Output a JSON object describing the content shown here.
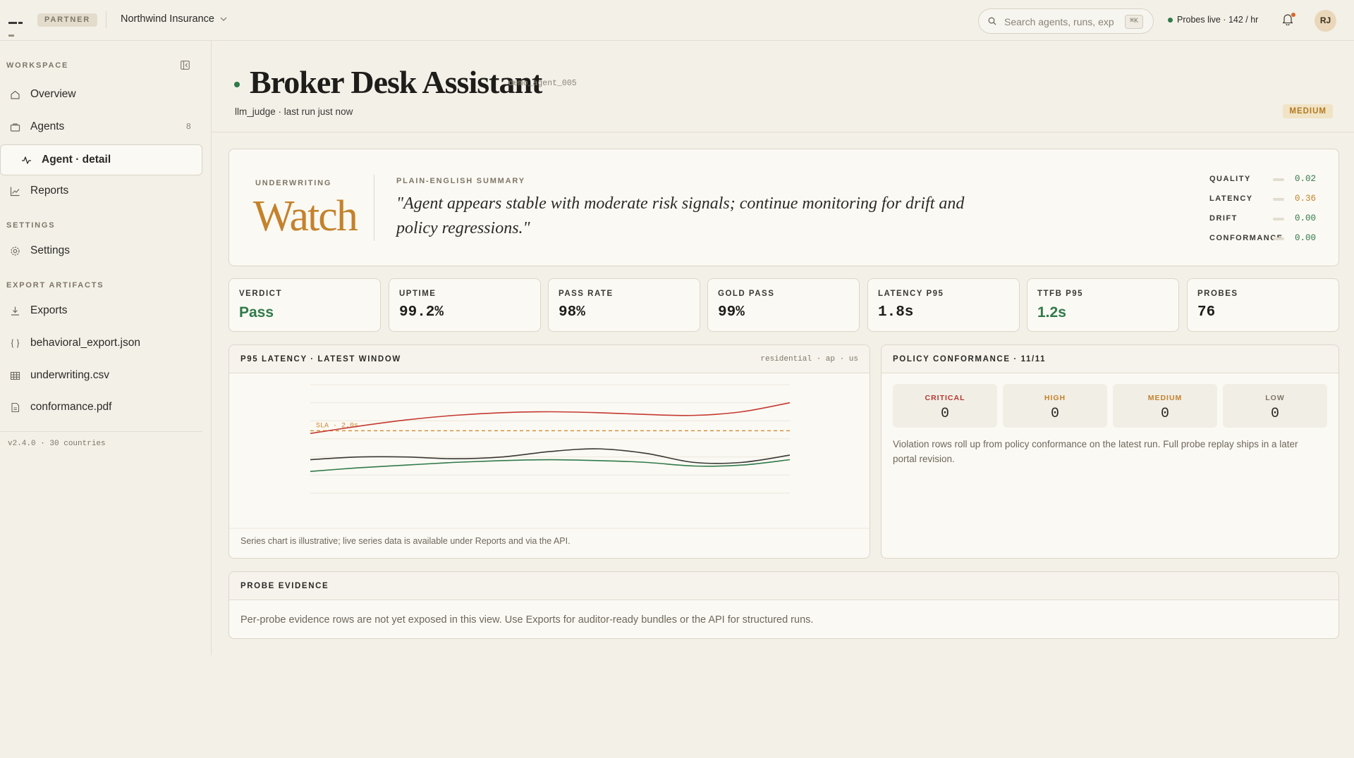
{
  "topbar": {
    "partner_label": "PARTNER",
    "org_name": "Northwind Insurance",
    "search_placeholder": "Search agents, runs, exp",
    "search_shortcut": "⌘K",
    "probes_status": "Probes live · 142 / hr",
    "avatar_initials": "RJ"
  },
  "sidebar": {
    "workspace_label": "WORKSPACE",
    "workspace_items": [
      {
        "label": "Overview",
        "icon": "home-icon"
      },
      {
        "label": "Agents",
        "icon": "briefcase-icon",
        "count": "8"
      },
      {
        "label": "Agent · detail",
        "icon": "pulse-icon",
        "active": true
      },
      {
        "label": "Reports",
        "icon": "chart-icon"
      }
    ],
    "settings_label": "SETTINGS",
    "settings_items": [
      {
        "label": "Settings",
        "icon": "gear-icon"
      }
    ],
    "export_label": "EXPORT ARTIFACTS",
    "export_items": [
      {
        "label": "Exports",
        "icon": "download-icon"
      },
      {
        "label": "behavioral_export.json",
        "icon": "braces-icon"
      },
      {
        "label": "underwriting.csv",
        "icon": "table-icon"
      },
      {
        "label": "conformance.pdf",
        "icon": "document-icon"
      }
    ],
    "version": "v2.4.0 · 30 countries"
  },
  "agent": {
    "name": "Broker Desk Assistant",
    "id": "demo_agent_005",
    "subtitle": "llm_judge · last run just now",
    "risk_badge": "MEDIUM"
  },
  "summary": {
    "category": "UNDERWRITING",
    "verdict": "Watch",
    "label": "PLAIN-ENGLISH SUMMARY",
    "quote": "\"Agent appears stable with moderate risk signals; continue monitoring for drift and policy regressions.\"",
    "metrics": [
      {
        "label": "QUALITY",
        "value": "0.02",
        "level": 0.02,
        "color": "#2f7a4a"
      },
      {
        "label": "LATENCY",
        "value": "0.36",
        "level": 0.36,
        "color": "#c4822c"
      },
      {
        "label": "DRIFT",
        "value": "0.00",
        "level": 0.0,
        "color": "#2f7a4a"
      },
      {
        "label": "CONFORMANCE",
        "value": "0.00",
        "level": 0.0,
        "color": "#2f7a4a"
      }
    ]
  },
  "kpis": [
    {
      "label": "VERDICT",
      "value": "Pass",
      "good": true
    },
    {
      "label": "UPTIME",
      "value": "99.2%"
    },
    {
      "label": "PASS RATE",
      "value": "98%"
    },
    {
      "label": "GOLD PASS",
      "value": "99%"
    },
    {
      "label": "LATENCY P95",
      "value": "1.8s"
    },
    {
      "label": "TTFB P95",
      "value": "1.2s",
      "good": true
    },
    {
      "label": "PROBES",
      "value": "76"
    }
  ],
  "latency_panel": {
    "title": "P95 LATENCY · LATEST WINDOW",
    "tags": "residential · ap · us",
    "footnote": "Series chart is illustrative; live series data is available under Reports and via the API."
  },
  "chart_data": {
    "type": "line",
    "x": [
      0,
      1,
      2,
      3,
      4,
      5,
      6,
      7,
      8,
      9,
      10
    ],
    "ylim": [
      0,
      6
    ],
    "threshold": {
      "label": "SLA · 2.0s",
      "value": 3.45,
      "color": "#d08a33"
    },
    "series": [
      {
        "color": "#c43a32",
        "values": [
          3.3,
          3.7,
          4.05,
          4.3,
          4.45,
          4.5,
          4.45,
          4.35,
          4.3,
          4.5,
          5.0
        ]
      },
      {
        "color": "#3a3833",
        "values": [
          1.85,
          2.0,
          2.0,
          1.9,
          2.0,
          2.3,
          2.45,
          2.2,
          1.7,
          1.7,
          2.1
        ]
      },
      {
        "color": "#2f7a4a",
        "values": [
          1.2,
          1.4,
          1.55,
          1.7,
          1.8,
          1.85,
          1.8,
          1.7,
          1.5,
          1.55,
          1.85
        ]
      }
    ]
  },
  "policy_panel": {
    "title": "POLICY CONFORMANCE · 11/11",
    "severities": [
      {
        "label": "CRITICAL",
        "count": "0",
        "color": "#b5392f"
      },
      {
        "label": "HIGH",
        "count": "0",
        "color": "#c4822c"
      },
      {
        "label": "MEDIUM",
        "count": "0",
        "color": "#c4822c"
      },
      {
        "label": "LOW",
        "count": "0",
        "color": "#7e7668"
      }
    ],
    "note": "Violation rows roll up from policy conformance on the latest run. Full probe replay ships in a later portal revision."
  },
  "evidence_panel": {
    "title": "PROBE EVIDENCE",
    "text": "Per-probe evidence rows are not yet exposed in this view. Use Exports for auditor-ready bundles or the API for structured runs."
  },
  "colors": {
    "accent": "#c4822c",
    "good": "#2f7a4a",
    "critical": "#b5392f",
    "background": "#f3f0e8"
  }
}
